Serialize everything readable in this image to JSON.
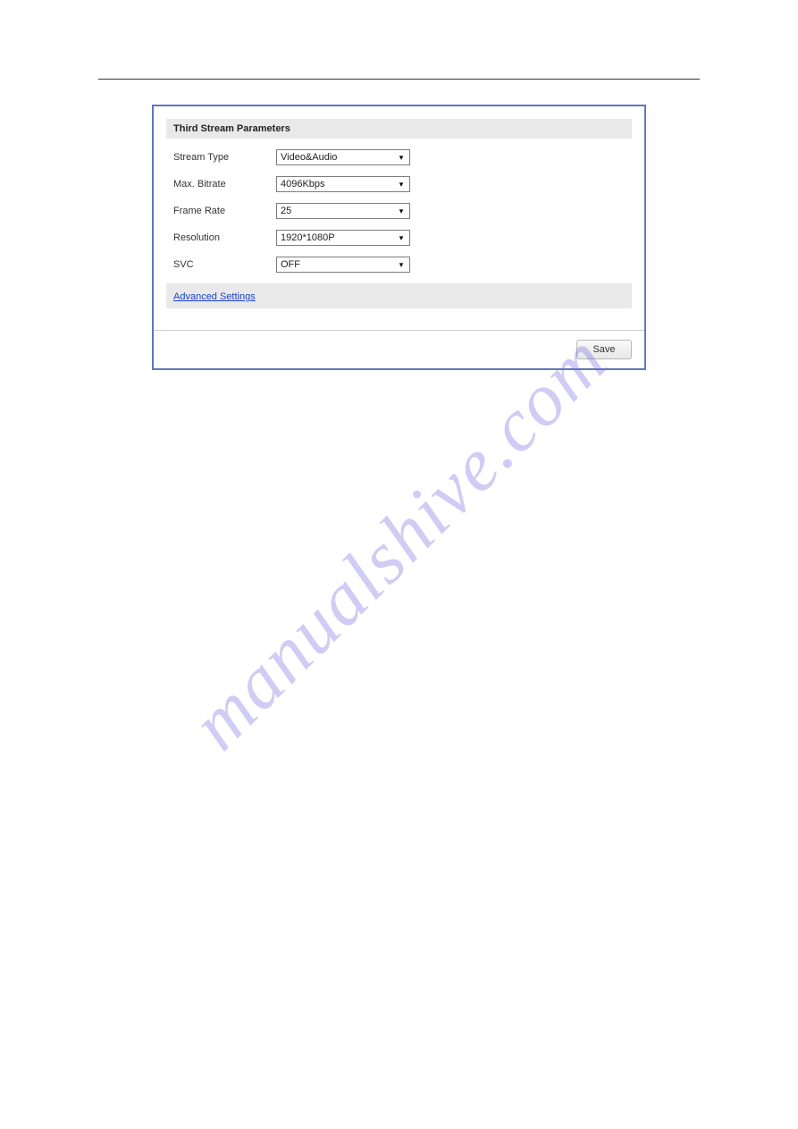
{
  "panel": {
    "section_title": "Third Stream Parameters",
    "rows": [
      {
        "label": "Stream Type",
        "value": "Video&Audio"
      },
      {
        "label": "Max. Bitrate",
        "value": "4096Kbps"
      },
      {
        "label": "Frame Rate",
        "value": "25"
      },
      {
        "label": "Resolution",
        "value": "1920*1080P"
      },
      {
        "label": "SVC",
        "value": "OFF"
      }
    ],
    "advanced_link": "Advanced Settings",
    "save_label": "Save"
  },
  "watermark": "manualshive.com"
}
